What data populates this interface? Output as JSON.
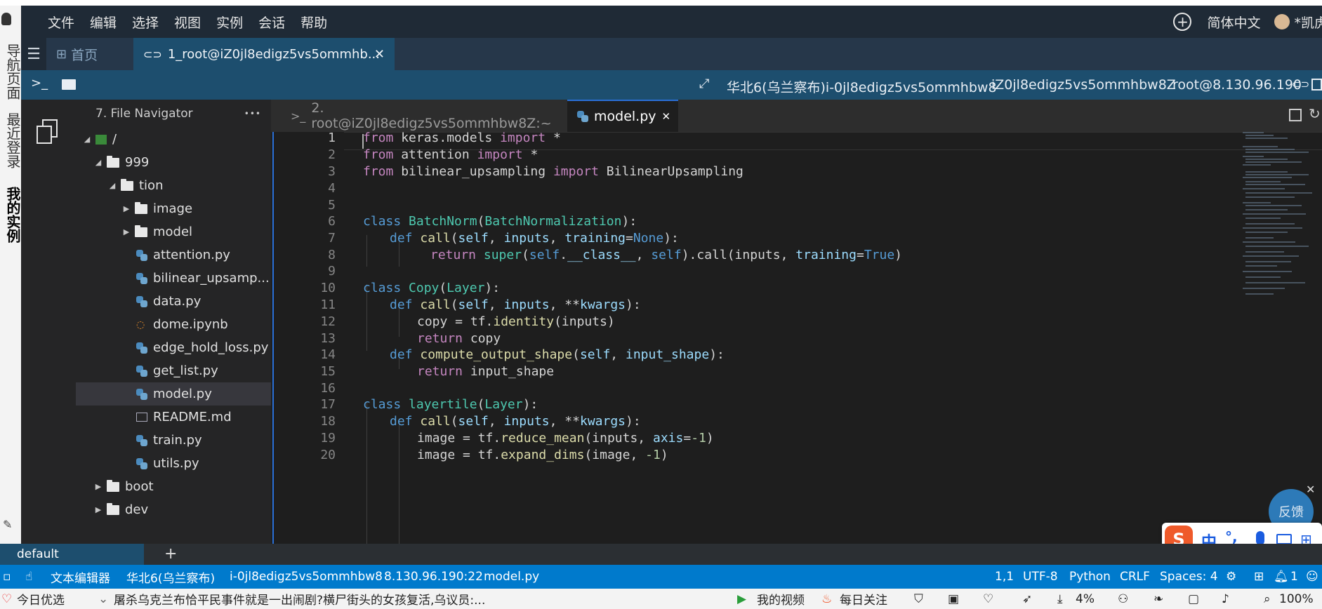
{
  "menubar": {
    "items": [
      "文件",
      "编辑",
      "选择",
      "视图",
      "实例",
      "会话",
      "帮助"
    ],
    "language": "简体中文",
    "user": "*凯虎"
  },
  "left_vertical": {
    "labels": [
      "导航页面",
      "最近登录",
      "我的实例"
    ]
  },
  "tabs": {
    "home": "首页",
    "session": "1_root@iZ0jl8edigz5vs5ommhb..."
  },
  "toolbar": {
    "region_instance": "华北6(乌兰察布)i-0jl8edigz5vs5ommhbw8",
    "hostname": "iZ0jl8edigz5vs5ommhbw8Z",
    "user_host": "root@8.130.96.190"
  },
  "file_nav": {
    "title": "7. File Navigator",
    "more": "•••",
    "tree": [
      {
        "label": "/",
        "type": "root",
        "depth": 0,
        "open": true
      },
      {
        "label": "999",
        "type": "folder",
        "depth": 1,
        "open": true
      },
      {
        "label": "tion",
        "type": "folder",
        "depth": 2,
        "open": true
      },
      {
        "label": "image",
        "type": "folder",
        "depth": 3,
        "open": false
      },
      {
        "label": "model",
        "type": "folder",
        "depth": 3,
        "open": false
      },
      {
        "label": "attention.py",
        "type": "py",
        "depth": 3
      },
      {
        "label": "bilinear_upsamp...",
        "type": "py",
        "depth": 3
      },
      {
        "label": "data.py",
        "type": "py",
        "depth": 3
      },
      {
        "label": "dome.ipynb",
        "type": "ipynb",
        "depth": 3
      },
      {
        "label": "edge_hold_loss.py",
        "type": "py",
        "depth": 3
      },
      {
        "label": "get_list.py",
        "type": "py",
        "depth": 3
      },
      {
        "label": "model.py",
        "type": "py",
        "depth": 3,
        "selected": true
      },
      {
        "label": "README.md",
        "type": "md",
        "depth": 3
      },
      {
        "label": "train.py",
        "type": "py",
        "depth": 3
      },
      {
        "label": "utils.py",
        "type": "py",
        "depth": 3
      },
      {
        "label": "boot",
        "type": "folder",
        "depth": 1,
        "open": false
      },
      {
        "label": "dev",
        "type": "folder",
        "depth": 1,
        "open": false
      }
    ]
  },
  "editor_tabs": {
    "terminal": "2. root@iZ0jl8edigz5vs5ommhbw8Z:~",
    "file": "model.py"
  },
  "code_lines": [
    "1",
    "2",
    "3",
    "4",
    "5",
    "6",
    "7",
    "8",
    "9",
    "10",
    "11",
    "12",
    "13",
    "14",
    "15",
    "16",
    "17",
    "18",
    "19",
    "20"
  ],
  "code": {
    "l1a": "from",
    "l1b": " keras.models ",
    "l1c": "import",
    "l1d": " *",
    "l2a": "from",
    "l2b": " attention ",
    "l2c": "import",
    "l2d": " *",
    "l3a": "from",
    "l3b": " bilinear_upsampling ",
    "l3c": "import",
    "l3d": " BilinearUpsampling",
    "l6a": "class",
    "l6b": " BatchNorm",
    "l6c": "(",
    "l6d": "BatchNormalization",
    "l6e": "):",
    "l7a": "def",
    "l7b": " call",
    "l7c": "(",
    "l7d": "self",
    "l7e": ", ",
    "l7f": "inputs",
    "l7g": ", ",
    "l7h": "training",
    "l7i": "=",
    "l7j": "None",
    "l7k": "):",
    "l8a": "return",
    "l8b": " super",
    "l8c": "(",
    "l8d": "self",
    "l8e": ".",
    "l8f": "__class__",
    "l8g": ", ",
    "l8h": "self",
    "l8i": ").call(inputs, ",
    "l8j": "training",
    "l8k": "=",
    "l8l": "True",
    "l8m": ")",
    "l10a": "class",
    "l10b": " Copy",
    "l10c": "(",
    "l10d": "Layer",
    "l10e": "):",
    "l11a": "def",
    "l11b": " call",
    "l11c": "(",
    "l11d": "self",
    "l11e": ", ",
    "l11f": "inputs",
    "l11g": ", **",
    "l11h": "kwargs",
    "l11i": "):",
    "l12a": "copy = tf.",
    "l12b": "identity",
    "l12c": "(inputs)",
    "l13a": "return",
    "l13b": " copy",
    "l14a": "def",
    "l14b": " compute_output_shape",
    "l14c": "(",
    "l14d": "self",
    "l14e": ", ",
    "l14f": "input_shape",
    "l14g": "):",
    "l15a": "return",
    "l15b": " input_shape",
    "l17a": "class",
    "l17b": " layertile",
    "l17c": "(",
    "l17d": "Layer",
    "l17e": "):",
    "l18a": "def",
    "l18b": " call",
    "l18c": "(",
    "l18d": "self",
    "l18e": ", ",
    "l18f": "inputs",
    "l18g": ", **",
    "l18h": "kwargs",
    "l18i": "):",
    "l19a": "image = tf.",
    "l19b": "reduce_mean",
    "l19c": "(inputs, ",
    "l19d": "axis",
    "l19e": "=",
    "l19f": "-1",
    "l19g": ")",
    "l20a": "image = tf.",
    "l20b": "expand_dims",
    "l20c": "(image, ",
    "l20d": "-1",
    "l20e": ")"
  },
  "feedback": "反馈",
  "ime": {
    "lang": "中",
    "punct": "°,"
  },
  "terminal_strip": {
    "name": "default",
    "add": "+"
  },
  "statusbar": {
    "editor": "文本编辑器",
    "region": "华北6(乌兰察布)",
    "instance": "i-0jl8edigz5vs5ommhbw8",
    "ip": "8.130.96.190:22",
    "file": "model.py",
    "position": "1,1",
    "encoding": "UTF-8",
    "language": "Python",
    "eol": "CRLF",
    "spaces": "Spaces: 4",
    "notifications": "1"
  },
  "taskbar": {
    "picks": "今日优选",
    "news": "屠杀乌克兰布恰平民事件就是一出闹剧?横尸街头的女孩复活,乌议员:...",
    "videos": "我的视频",
    "daily": "每日关注",
    "cpu": "4%",
    "zoom": "100%"
  },
  "colors": {
    "status_blue": "#007acc",
    "toolbar_blue": "#1d4e6e",
    "tab_accent": "#2a6fd6"
  }
}
